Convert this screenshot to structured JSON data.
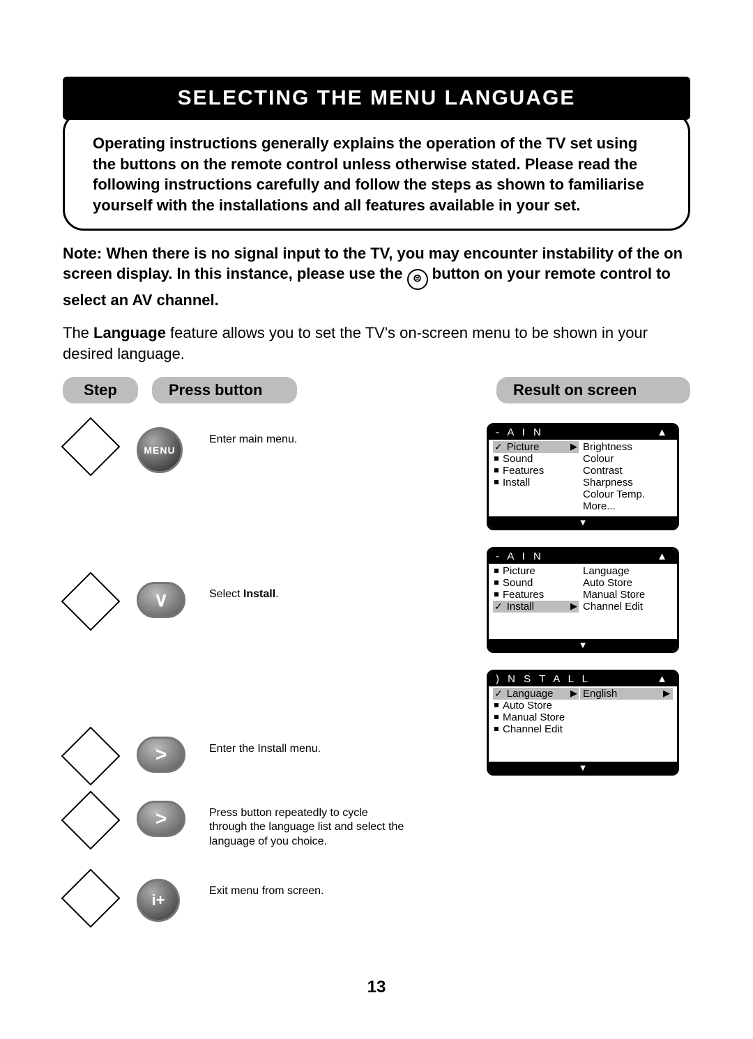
{
  "title": "SELECTING THE MENU LANGUAGE",
  "intro": "Operating instructions generally explains the operation of the TV set using the buttons on the remote control unless otherwise stated. Please read the following instructions carefully and follow the steps as shown to familiarise yourself with the installations and all features available in your set.",
  "note_pre": "Note: When there is no signal input to the TV, you may encounter instability of the on screen display. In this instance, please use the ",
  "note_post": " button on your remote control to select an AV channel.",
  "description_pre": "The ",
  "description_bold": "Language",
  "description_post": " feature allows you to set the TV's on-screen menu to be shown in your desired language.",
  "headers": {
    "step": "Step",
    "press": "Press button",
    "result": "Result on screen"
  },
  "buttons": {
    "menu": "MENU",
    "down": "∨",
    "right": ">",
    "info": "i+"
  },
  "actions": {
    "a1": "Enter main menu.",
    "a2_pre": "Select ",
    "a2_bold": "Install",
    "a2_post": ".",
    "a3": "Enter the Install menu.",
    "a4": "Press button repeatedly to cycle through the language list and select the language of you choice.",
    "a5": "Exit menu from screen."
  },
  "osd1": {
    "header": "- A I N",
    "left": [
      {
        "label": "Picture",
        "selected": true
      },
      {
        "label": "Sound"
      },
      {
        "label": "Features"
      },
      {
        "label": "Install"
      }
    ],
    "right": [
      "Brightness",
      "Colour",
      "Contrast",
      "Sharpness",
      "Colour Temp.",
      "More..."
    ]
  },
  "osd2": {
    "header": "- A I N",
    "left": [
      {
        "label": "Picture"
      },
      {
        "label": "Sound"
      },
      {
        "label": "Features"
      },
      {
        "label": "Install",
        "selected": true
      }
    ],
    "right": [
      "Language",
      "Auto Store",
      "Manual Store",
      "Channel Edit"
    ]
  },
  "osd3": {
    "header": ") N S T A L L",
    "left": [
      {
        "label": "Language",
        "selected": true
      },
      {
        "label": "Auto Store"
      },
      {
        "label": "Manual Store"
      },
      {
        "label": "Channel Edit"
      }
    ],
    "right_selected": "English"
  },
  "arrows": {
    "up": "▲",
    "down": "▼",
    "right": "▶"
  },
  "page": "13",
  "input_icon": "⊜"
}
